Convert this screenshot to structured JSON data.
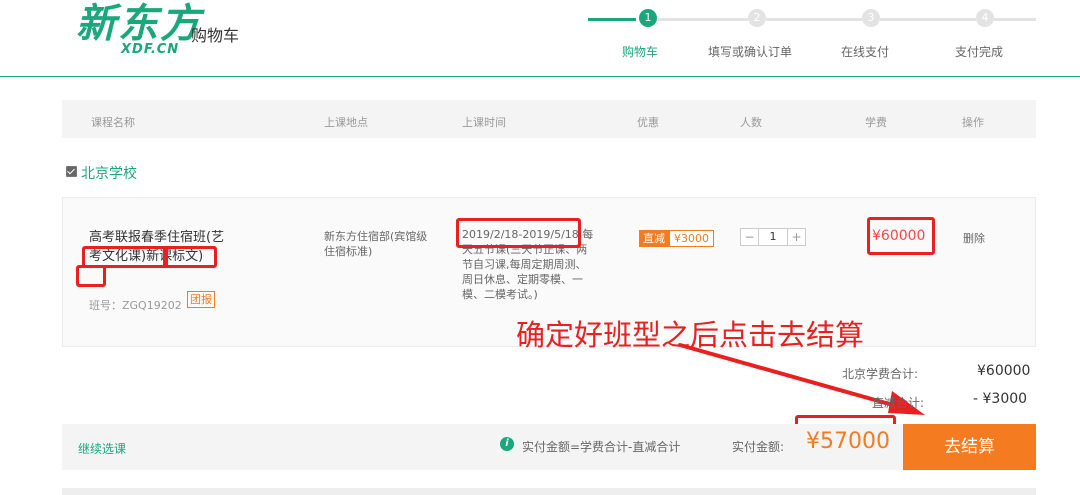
{
  "header": {
    "logo_main": "新东方",
    "logo_sub": "XDF.CN",
    "title": "购物车"
  },
  "steps": [
    {
      "num": "1",
      "label": "购物车"
    },
    {
      "num": "2",
      "label": "填写或确认订单"
    },
    {
      "num": "3",
      "label": "在线支付"
    },
    {
      "num": "4",
      "label": "支付完成"
    }
  ],
  "table": {
    "headers": [
      "课程名称",
      "上课地点",
      "上课时间",
      "优惠",
      "人数",
      "学费",
      "操作"
    ]
  },
  "school": {
    "name": "北京学校",
    "checked": true
  },
  "course": {
    "name": "高考联报春季住宿班(艺考文化课)新课标文)",
    "class_no": "班号：ZGQ19202",
    "group_badge": "团报",
    "location": "新东方住宿部(宾馆级住宿标准)",
    "time": "2019/2/18-2019/5/18 每天五节课(三天节正课、两节自习课,每周定期周测、周日休息、定期零模、一模、二模考试。)",
    "discount_type": "直减",
    "discount_amount": "¥3000",
    "qty_minus": "−",
    "qty_value": "1",
    "qty_plus": "+",
    "fee": "¥60000",
    "delete": "删除"
  },
  "annotation": "确定好班型之后点击去结算",
  "totals": {
    "fee_label": "北京学费合计:",
    "fee_value": "¥60000",
    "reduce_label": "直减合计:",
    "reduce_value": "- ¥3000"
  },
  "footer": {
    "continue": "继续选课",
    "info_icon": "i",
    "formula": "实付金额=学费合计-直减合计",
    "actual_label": "实付金额:",
    "actual_amount": "¥57000",
    "checkout": "去结算"
  },
  "colors": {
    "brand_green": "#1aa77b",
    "accent_orange": "#f47b20",
    "annotation_red": "#e82020"
  }
}
